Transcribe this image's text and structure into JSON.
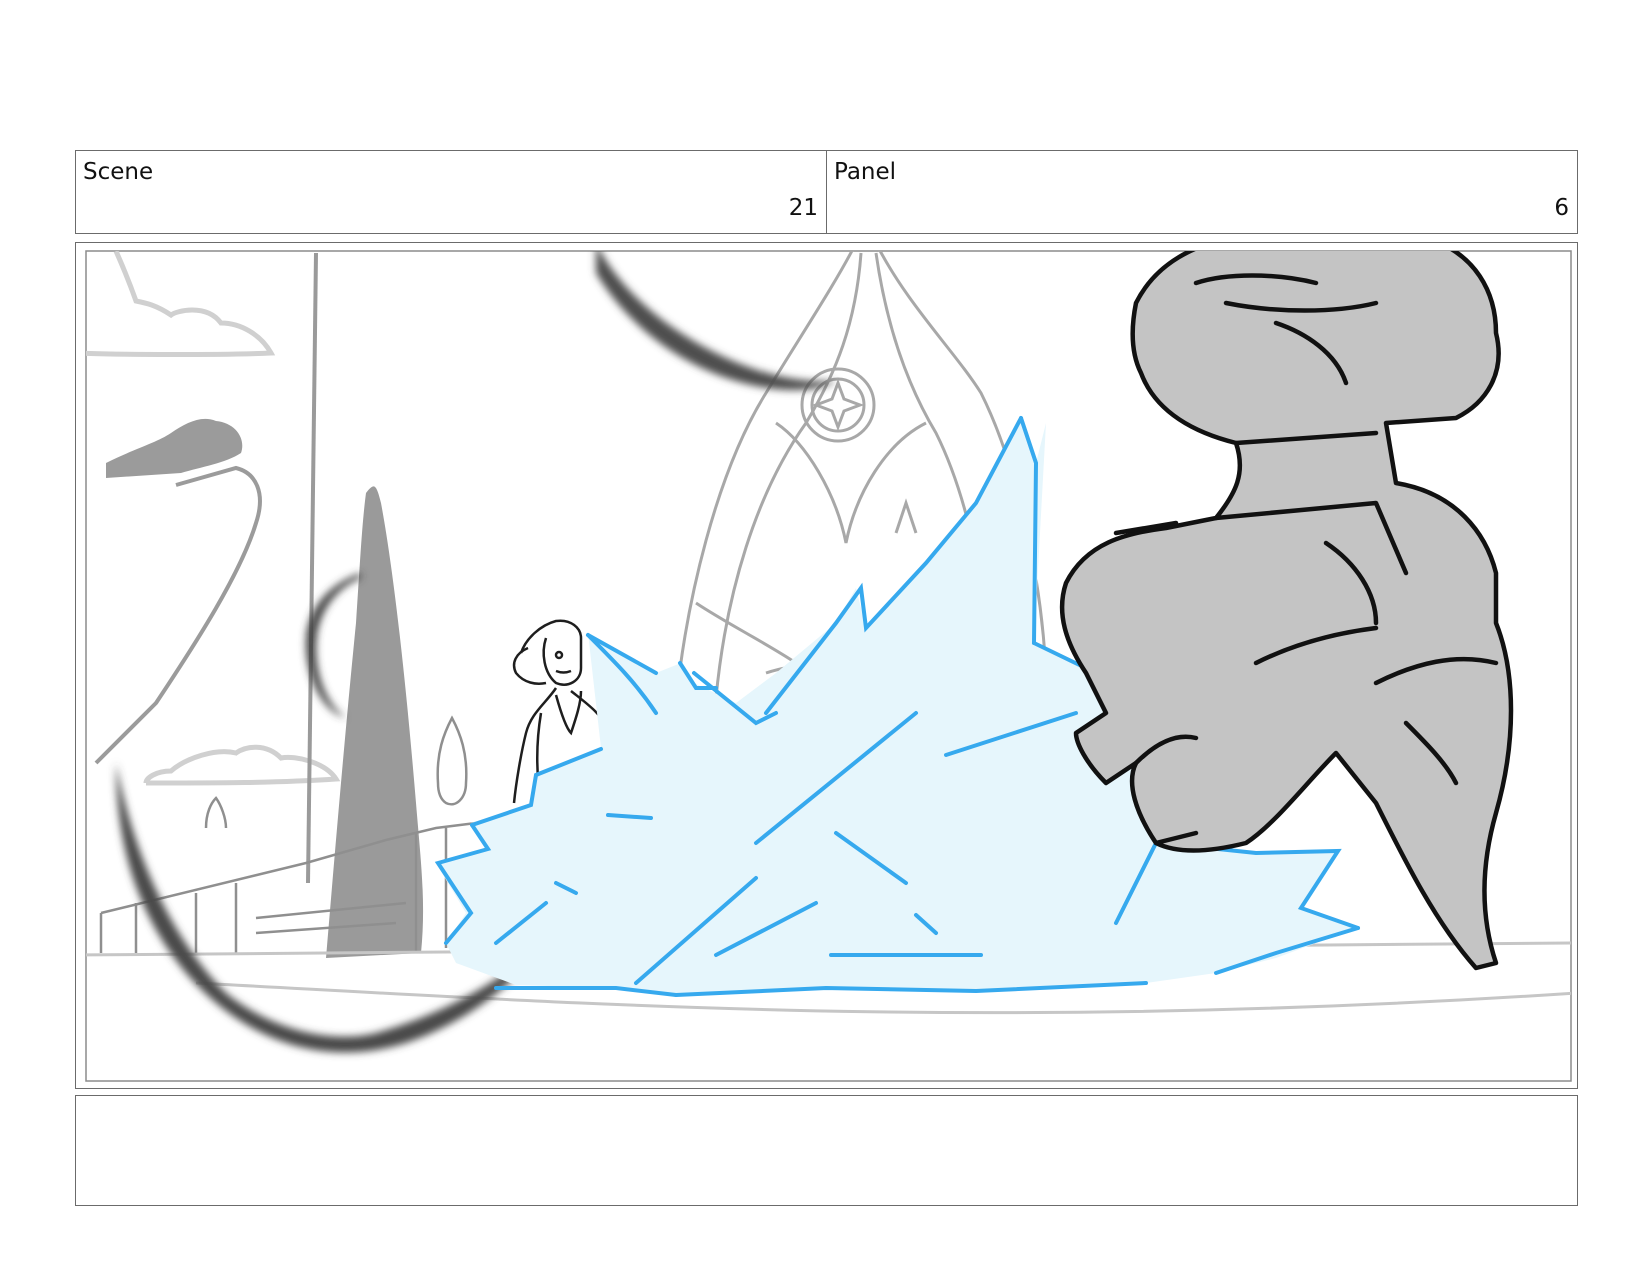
{
  "header": {
    "scene_label": "Scene",
    "scene_number": "21",
    "panel_label": "Panel",
    "panel_number": "6"
  },
  "drawing": {
    "line_color": "#1e1e1e",
    "sketch_gray": "#a6a6a6",
    "fill_gray": "#c4c4c4",
    "effect_color": "#36a9ee",
    "effect_fill": "#e6f6fc"
  },
  "notes": {
    "text": ""
  }
}
